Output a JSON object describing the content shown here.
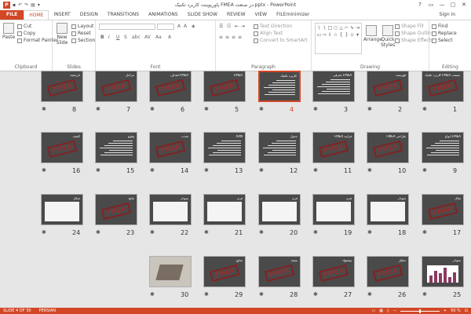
{
  "window": {
    "title": "پاورپوینت کاربرد تکنیک FMEA در صنعت.pptx - PowerPoint",
    "controls": [
      "?",
      "▭",
      "—",
      "▢",
      "✕"
    ]
  },
  "tabs": [
    {
      "label": "FILE"
    },
    {
      "label": "HOME"
    },
    {
      "label": "INSERT"
    },
    {
      "label": "DESIGN"
    },
    {
      "label": "TRANSITIONS"
    },
    {
      "label": "ANIMATIONS"
    },
    {
      "label": "SLIDE SHOW"
    },
    {
      "label": "REVIEW"
    },
    {
      "label": "VIEW"
    },
    {
      "label": "FILEminimizer"
    }
  ],
  "signin": "Sign in",
  "ribbon": {
    "clipboard": {
      "label": "Clipboard",
      "paste": "Paste",
      "cut": "Cut",
      "copy": "Copy",
      "format_painter": "Format Painter"
    },
    "slides": {
      "label": "Slides",
      "new_slide": "New",
      "new_slide2": "Slide",
      "layout": "Layout",
      "reset": "Reset",
      "section": "Section"
    },
    "font": {
      "label": "Font"
    },
    "paragraph": {
      "label": "Paragraph",
      "text_direction": "Text Direction",
      "align_text": "Align Text",
      "convert": "Convert to SmartArt"
    },
    "drawing": {
      "label": "Drawing",
      "arrange": "Arrange",
      "quick_styles": "Quick",
      "quick_styles2": "Styles",
      "shape_fill": "Shape Fill",
      "shape_outline": "Shape Outline",
      "shape_effects": "Shape Effects"
    },
    "editing": {
      "label": "Editing",
      "find": "Find",
      "replace": "Replace",
      "select": "Select"
    }
  },
  "slides": [
    {
      "n": "1",
      "title": "کاربرد تکنیک FMEA در صنعت",
      "type": "stamp"
    },
    {
      "n": "2",
      "title": "فهرست",
      "type": "stamp"
    },
    {
      "n": "3",
      "title": "معرفی FMEA",
      "type": "text"
    },
    {
      "n": "4",
      "title": "کاربرد تکنیک",
      "type": "text"
    },
    {
      "n": "5",
      "title": "FMEA",
      "type": "stamp"
    },
    {
      "n": "6",
      "title": "اهداف FMEA",
      "type": "stamp"
    },
    {
      "n": "7",
      "title": "مراحل",
      "type": "stamp"
    },
    {
      "n": "8",
      "title": "تاریخچه",
      "type": "stamp"
    },
    {
      "n": "9",
      "title": "انواع FMEA",
      "type": "text"
    },
    {
      "n": "10",
      "title": "FMEA طراحی",
      "type": "stamp"
    },
    {
      "n": "11",
      "title": "FMEA فرآیند",
      "type": "stamp"
    },
    {
      "n": "12",
      "title": "جدول",
      "type": "text"
    },
    {
      "n": "13",
      "title": "RPN",
      "type": "text"
    },
    {
      "n": "14",
      "title": "شدت",
      "type": "stamp"
    },
    {
      "n": "15",
      "title": "وقوع",
      "type": "table"
    },
    {
      "n": "16",
      "title": "کشف",
      "type": "stamp"
    },
    {
      "n": "17",
      "title": "مثال",
      "type": "stamp"
    },
    {
      "n": "18",
      "title": "نمودار",
      "type": "white"
    },
    {
      "n": "19",
      "title": "فرم",
      "type": "white"
    },
    {
      "n": "20",
      "title": "فرم",
      "type": "white"
    },
    {
      "n": "21",
      "title": "فرم",
      "type": "white"
    },
    {
      "n": "22",
      "title": "نمودار",
      "type": "white"
    },
    {
      "n": "23",
      "title": "نتایج",
      "type": "stamp"
    },
    {
      "n": "24",
      "title": "شکل",
      "type": "white"
    },
    {
      "n": "25",
      "title": "نمودار",
      "type": "chart"
    },
    {
      "n": "26",
      "title": "تحلیل",
      "type": "stamp"
    },
    {
      "n": "27",
      "title": "پیشنهاد",
      "type": "stamp"
    },
    {
      "n": "28",
      "title": "نتیجه",
      "type": "stamp"
    },
    {
      "n": "29",
      "title": "منابع",
      "type": "stamp"
    },
    {
      "n": "30",
      "title": "",
      "type": "photo"
    }
  ],
  "stamp_text": "FMEA",
  "selected_slide": "4",
  "status": {
    "slide": "SLIDE 4 OF 30",
    "language": "PERSIAN",
    "zoom": "50 %"
  }
}
